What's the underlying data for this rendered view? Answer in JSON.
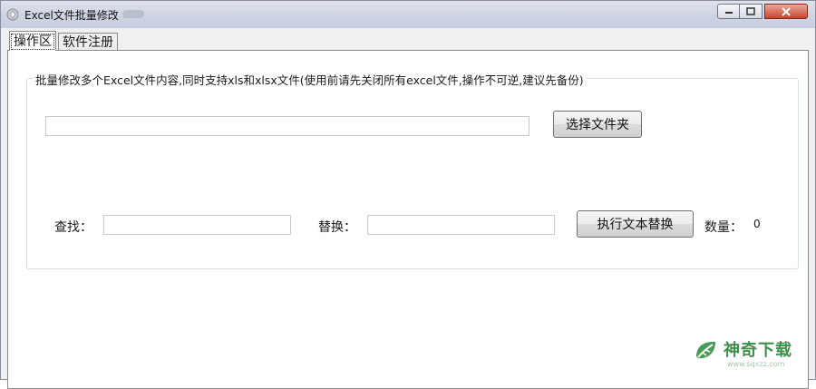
{
  "window": {
    "title": "Excel文件批量修改",
    "controls": {
      "minimize": "—",
      "maximize": "□",
      "close": "✕"
    }
  },
  "tabs": [
    {
      "label": "操作区",
      "active": true
    },
    {
      "label": "软件注册",
      "active": false
    }
  ],
  "group": {
    "legend": "批量修改多个Excel文件内容,同时支持xls和xlsx文件(使用前请先关闭所有excel文件,操作不可逆,建议先备份)"
  },
  "folder": {
    "path_value": "",
    "select_button": "选择文件夹"
  },
  "replace": {
    "find_label": "查找：",
    "find_value": "",
    "replace_label": "替换：",
    "replace_value": "",
    "execute_button": "执行文本替换",
    "count_label": "数量：",
    "count_value": "0"
  },
  "watermark": {
    "text": "神奇下载",
    "url": "www.sqxzz.com",
    "color": "#3f8f4d"
  },
  "icons": {
    "app": "app-icon",
    "leaf": "leaf-logo-icon"
  }
}
